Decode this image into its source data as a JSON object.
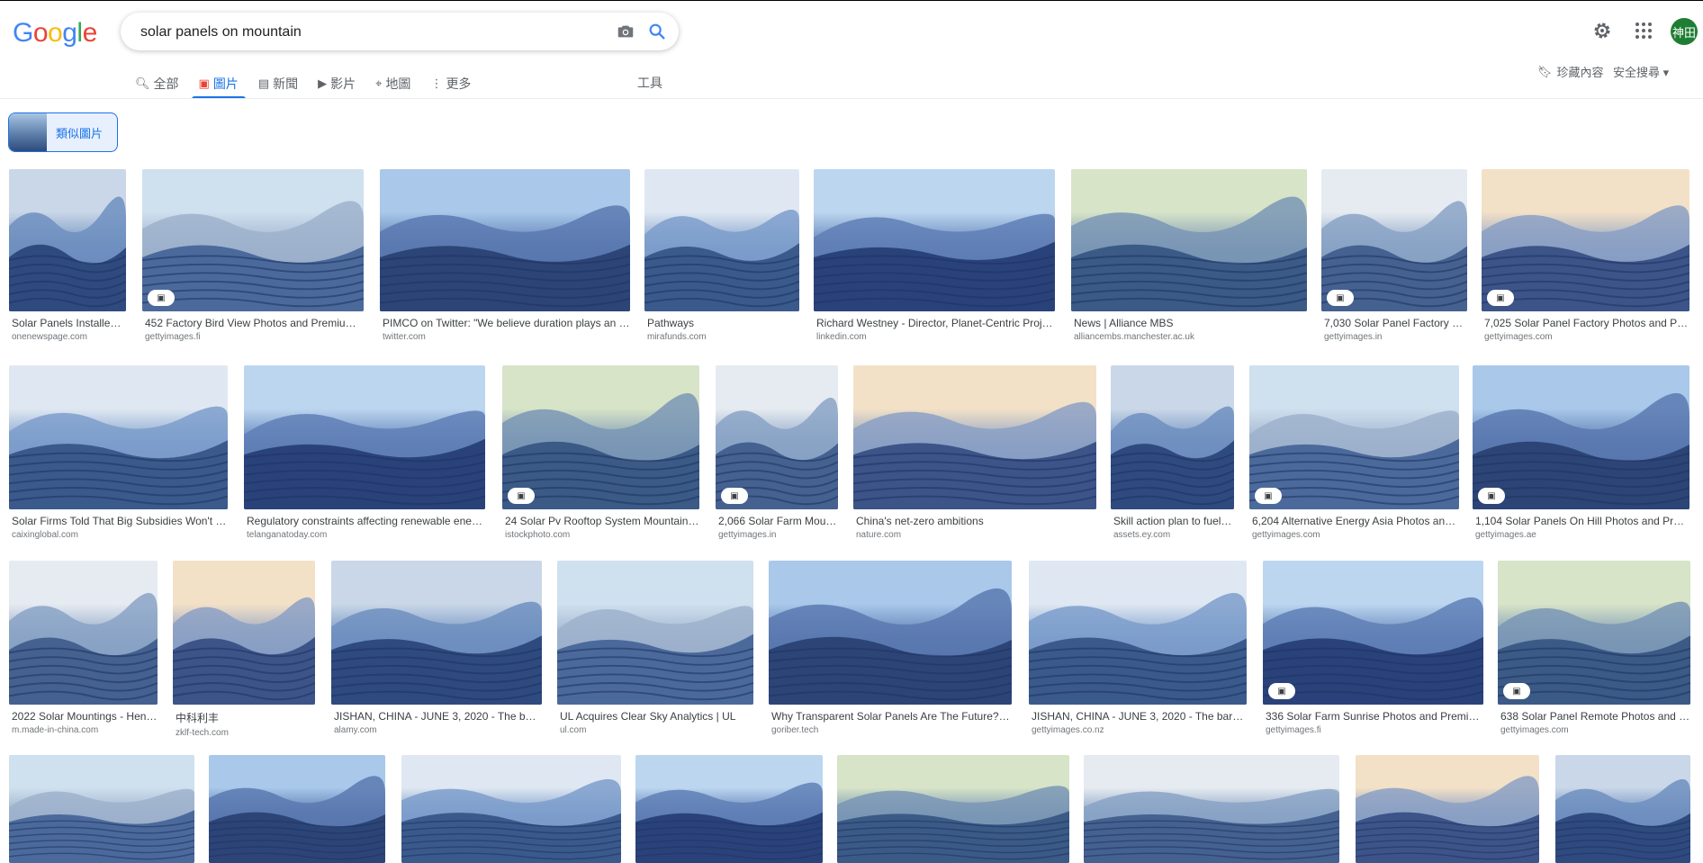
{
  "logo": {
    "letters": [
      "G",
      "o",
      "o",
      "g",
      "l",
      "e"
    ],
    "colors": [
      "#4285f4",
      "#ea4335",
      "#fbbc05",
      "#4285f4",
      "#34a853",
      "#ea4335"
    ]
  },
  "search": {
    "query": "solar panels on mountain"
  },
  "account": {
    "avatar_text": "神田"
  },
  "tabs": [
    {
      "label": "全部",
      "icon": "magnifier-icon"
    },
    {
      "label": "圖片",
      "icon": "image-icon",
      "active": true
    },
    {
      "label": "新聞",
      "icon": "news-icon"
    },
    {
      "label": "影片",
      "icon": "play-icon"
    },
    {
      "label": "地圖",
      "icon": "pin-icon"
    },
    {
      "label": "更多",
      "icon": "more-dots-icon"
    }
  ],
  "tools_label": "工具",
  "saved_label": "珍藏內容",
  "safesearch_label": "安全搜尋",
  "similar_chip_label": "類似圖片",
  "accent": "#1a73e8",
  "results": [
    {
      "title": "Solar Panels Installed ...",
      "site": "onenewspage.com"
    },
    {
      "title": "452 Factory Bird View Photos and Premium Hi...",
      "site": "gettyimages.fi",
      "badge": true
    },
    {
      "title": "PIMCO on Twitter: \"We believe duration plays an imp...",
      "site": "twitter.com"
    },
    {
      "title": "Pathways",
      "site": "mirafunds.com"
    },
    {
      "title": "Richard Westney - Director, Planet-Centric Project ...",
      "site": "linkedin.com"
    },
    {
      "title": "News | Alliance MBS",
      "site": "alliancembs.manchester.ac.uk"
    },
    {
      "title": "7,030 Solar Panel Factory Ph...",
      "site": "gettyimages.in",
      "badge": true
    },
    {
      "title": "7,025 Solar Panel Factory Photos and Premi...",
      "site": "gettyimages.com",
      "badge": true
    },
    {
      "title": "Solar Firms Told That Big Subsidies Won't Ret...",
      "site": "caixinglobal.com"
    },
    {
      "title": "Regulatory constraints affecting renewable energy ...",
      "site": "telanganatoday.com"
    },
    {
      "title": "24 Solar Pv Rooftop System Mountain Ba...",
      "site": "istockphoto.com",
      "badge": true
    },
    {
      "title": "2,066 Solar Farm Mount...",
      "site": "gettyimages.in",
      "badge": true
    },
    {
      "title": "China's net-zero ambitions",
      "site": "nature.com"
    },
    {
      "title": "Skill action plan to fuel t...",
      "site": "assets.ey.com"
    },
    {
      "title": "6,204 Alternative Energy Asia Photos and Pr...",
      "site": "gettyimages.com",
      "badge": true
    },
    {
      "title": "1,104 Solar Panels On Hill Photos and Premiu...",
      "site": "gettyimages.ae",
      "badge": true
    },
    {
      "title": "2022 Solar Mountings - Henan...",
      "site": "m.made-in-china.com"
    },
    {
      "title": "中科利丰",
      "site": "zklf-tech.com"
    },
    {
      "title": "JISHAN, CHINA - JUNE 3, 2020 - The barren ...",
      "site": "alamy.com"
    },
    {
      "title": "UL Acquires Clear Sky Analytics | UL",
      "site": "ul.com"
    },
    {
      "title": "Why Transparent Solar Panels Are The Future? - Gor...",
      "site": "goriber.tech"
    },
    {
      "title": "JISHAN, CHINA - JUNE 3, 2020 - The barren sl...",
      "site": "gettyimages.co.nz"
    },
    {
      "title": "336 Solar Farm Sunrise Photos and Premium ...",
      "site": "gettyimages.fi",
      "badge": true
    },
    {
      "title": "638 Solar Panel Remote Photos and Pre...",
      "site": "gettyimages.com",
      "badge": true
    },
    {
      "title": "",
      "site": ""
    },
    {
      "title": "",
      "site": ""
    },
    {
      "title": "",
      "site": ""
    },
    {
      "title": "",
      "site": ""
    },
    {
      "title": "",
      "site": ""
    },
    {
      "title": "",
      "site": ""
    },
    {
      "title": "",
      "site": ""
    },
    {
      "title": "",
      "site": ""
    }
  ]
}
